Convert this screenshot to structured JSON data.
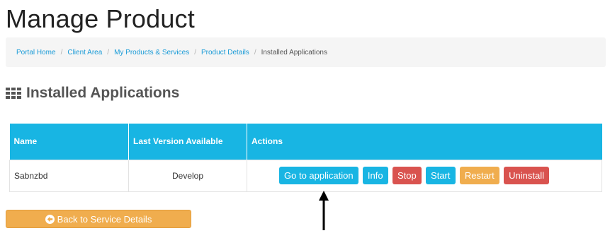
{
  "page_title": "Manage Product",
  "breadcrumb": {
    "items": [
      {
        "label": "Portal Home"
      },
      {
        "label": "Client Area"
      },
      {
        "label": "My Products & Services"
      },
      {
        "label": "Product Details"
      }
    ],
    "separator": "/",
    "active": "Installed Applications"
  },
  "section": {
    "title": "Installed Applications",
    "icon": "grid-icon"
  },
  "table": {
    "headers": {
      "name": "Name",
      "version": "Last Version Available",
      "actions": "Actions"
    },
    "rows": [
      {
        "name": "Sabnzbd",
        "version": "Develop",
        "buttons": {
          "go_to_app": "Go to application",
          "info": "Info",
          "stop": "Stop",
          "start": "Start",
          "restart": "Restart",
          "uninstall": "Uninstall"
        }
      }
    ]
  },
  "back_button": {
    "label": "Back to Service Details",
    "icon": "arrow-circle-left-icon"
  },
  "colors": {
    "primary": "#18b5e3",
    "danger": "#d9534f",
    "warning": "#f0ad4e",
    "link": "#1a9bd7"
  }
}
